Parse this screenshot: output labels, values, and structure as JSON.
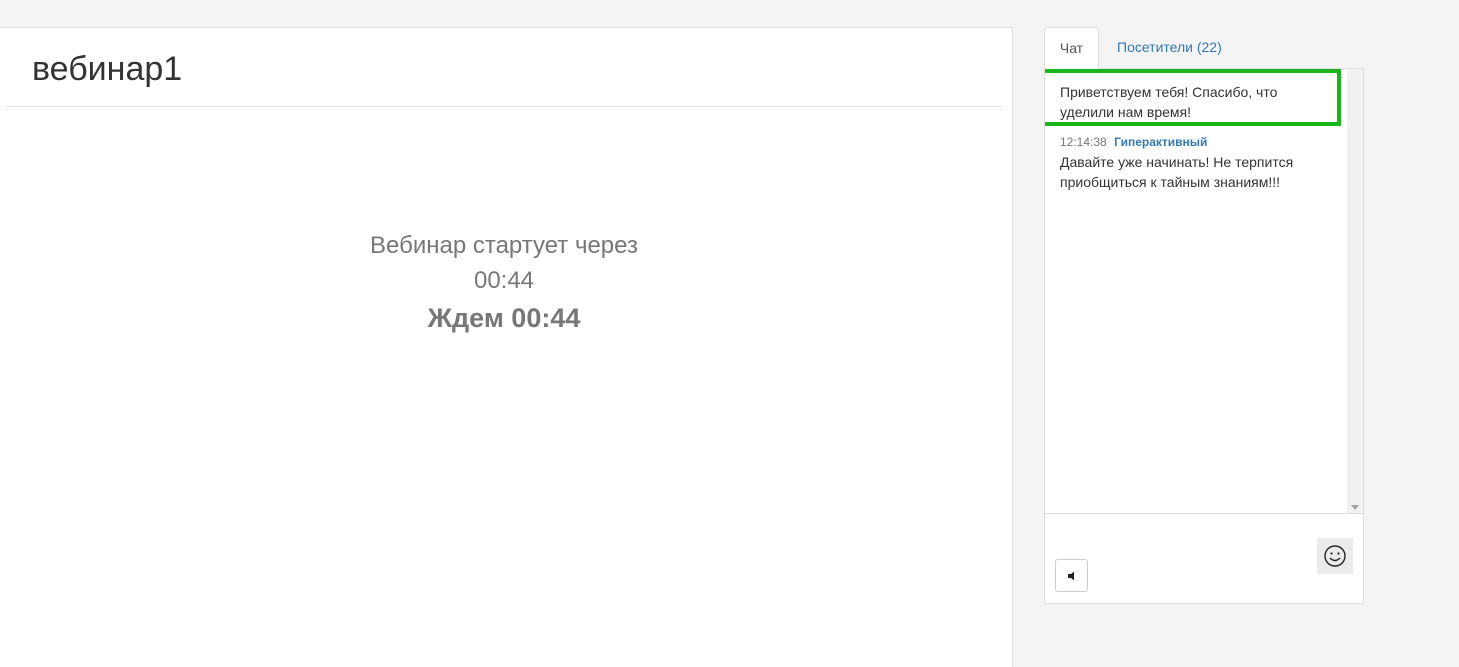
{
  "main": {
    "title": "вебинар1",
    "countdown": {
      "label": "Вебинар стартует через",
      "time": "00:44",
      "wait_text": "Ждем 00:44"
    }
  },
  "side": {
    "tabs": [
      {
        "label": "Чат",
        "active": true
      },
      {
        "label": "Посетители (22)",
        "active": false
      }
    ],
    "chat": {
      "pinned_message": "Приветствуем тебя! Спасибо, что уделили нам время!",
      "messages": [
        {
          "time": "12:14:38",
          "author": "Гиперактивный",
          "text": "Давайте уже начинать! Не терпится приобщиться к тайным знаниям!!!"
        }
      ]
    },
    "icons": {
      "sound": "speaker-icon",
      "emoji": "smiley-icon",
      "scroll": "scroll-down-arrow-icon"
    }
  },
  "colors": {
    "link": "#337ab7",
    "highlight": "#1ab51a",
    "muted_text": "#777777"
  }
}
